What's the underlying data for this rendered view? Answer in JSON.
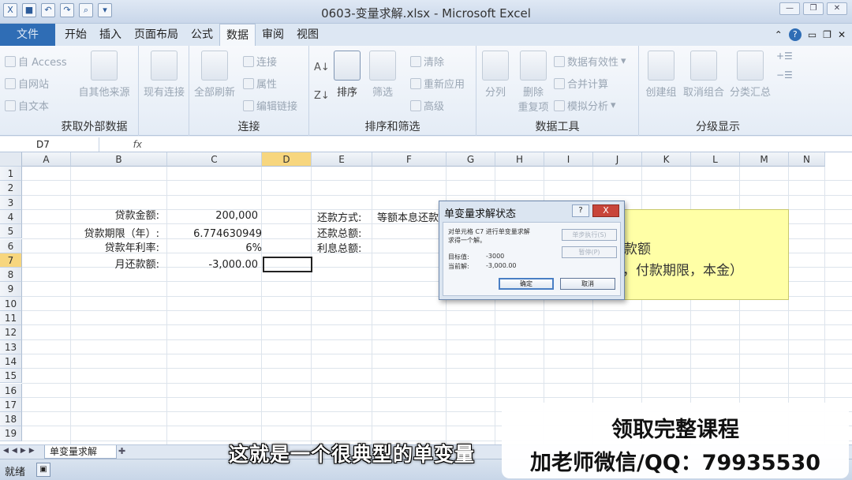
{
  "window": {
    "title": "0603-变量求解.xlsx - Microsoft Excel",
    "buttons": [
      "—",
      "❐",
      "✕"
    ]
  },
  "tabs": [
    "文件",
    "开始",
    "插入",
    "页面布局",
    "公式",
    "数据",
    "审阅",
    "视图"
  ],
  "active_tab": "数据",
  "ribbon": {
    "external": {
      "label": "获取外部数据",
      "access": "自 Access",
      "web": "自网站",
      "text": "自文本",
      "other": "自其他来源",
      "existing": "现有连接"
    },
    "connections": {
      "label": "连接",
      "refresh": "全部刷新",
      "connect": "连接",
      "props": "属性",
      "edit": "编辑链接"
    },
    "sort": {
      "label": "排序和筛选",
      "sort": "排序",
      "filter": "筛选",
      "clear": "清除",
      "reapply": "重新应用",
      "advanced": "高级"
    },
    "tools": {
      "label": "数据工具",
      "split": "分列",
      "dedupe": "删除\n重复项",
      "dedupe1": "删除",
      "dedupe2": "重复项",
      "validation": "数据有效性",
      "consolidate": "合并计算",
      "whatif": "模拟分析"
    },
    "outline": {
      "label": "分级显示",
      "group": "创建组",
      "ungroup": "取消组合",
      "subtotal": "分类汇总"
    }
  },
  "formula_bar": {
    "name_box": "D7",
    "fx": "fx",
    "content": ""
  },
  "columns": [
    "A",
    "B",
    "C",
    "D",
    "E",
    "F",
    "G",
    "H",
    "I",
    "J",
    "K",
    "L",
    "M",
    "N"
  ],
  "rows": [
    "1",
    "2",
    "3",
    "4",
    "5",
    "6",
    "7",
    "8",
    "9",
    "10",
    "11",
    "12",
    "13",
    "14",
    "15",
    "16",
    "17",
    "18",
    "19"
  ],
  "cells": {
    "b4": "贷款金额:",
    "c4": "200,000",
    "b5": "贷款期限（年）:",
    "c5": "6.774630949",
    "b6": "贷款年利率:",
    "c6": "6%",
    "b7": "月还款额:",
    "c7": "-3,000.00",
    "e4": "还款方式:",
    "f4": "等额本息还款",
    "e5": "还款总额:",
    "e6": "利息总额:"
  },
  "note": {
    "line1": "款额",
    "line2": "，付款期限，本金）"
  },
  "dialog": {
    "title": "单变量求解状态",
    "help": "?",
    "close": "X",
    "message1": "对单元格 C7 进行单变量求解",
    "message2": "求得一个解。",
    "target_label": "目标值:",
    "target_value": "-3000",
    "current_label": "当前解:",
    "current_value": "-3,000.00",
    "step_button": "单步执行(S)",
    "pause_button": "暂停(P)",
    "ok_button": "确定",
    "cancel_button": "取消"
  },
  "sheet_tab": "单变量求解",
  "status": "就绪",
  "subtitle": "这就是一个很典型的单变量",
  "promo": {
    "line1": "领取完整课程",
    "line2": "加老师微信/QQ：79935530"
  }
}
